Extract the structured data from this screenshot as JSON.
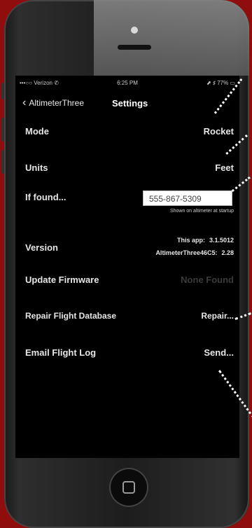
{
  "status": {
    "carrier": "•••○○ Verizon ✆",
    "time": "6:25 PM",
    "right": "⬈ ♯ 77% ▭"
  },
  "nav": {
    "back": "AltimeterThree",
    "title": "Settings"
  },
  "rows": {
    "mode": {
      "label": "Mode",
      "value": "Rocket"
    },
    "units": {
      "label": "Units",
      "value": "Feet"
    },
    "if_found": {
      "label": "If found...",
      "value": "555-867-5309",
      "hint": "Shown on altimeter at startup"
    },
    "version": {
      "label": "Version",
      "app_label": "This app:",
      "app_value": "3.1.5012",
      "device_label": "AltimeterThree46C5:",
      "device_value": "2.28"
    },
    "update_firmware": {
      "label": "Update Firmware",
      "value": "None Found"
    },
    "repair": {
      "label": "Repair Flight Database",
      "value": "Repair..."
    },
    "email": {
      "label": "Email Flight Log",
      "value": "Send..."
    }
  }
}
